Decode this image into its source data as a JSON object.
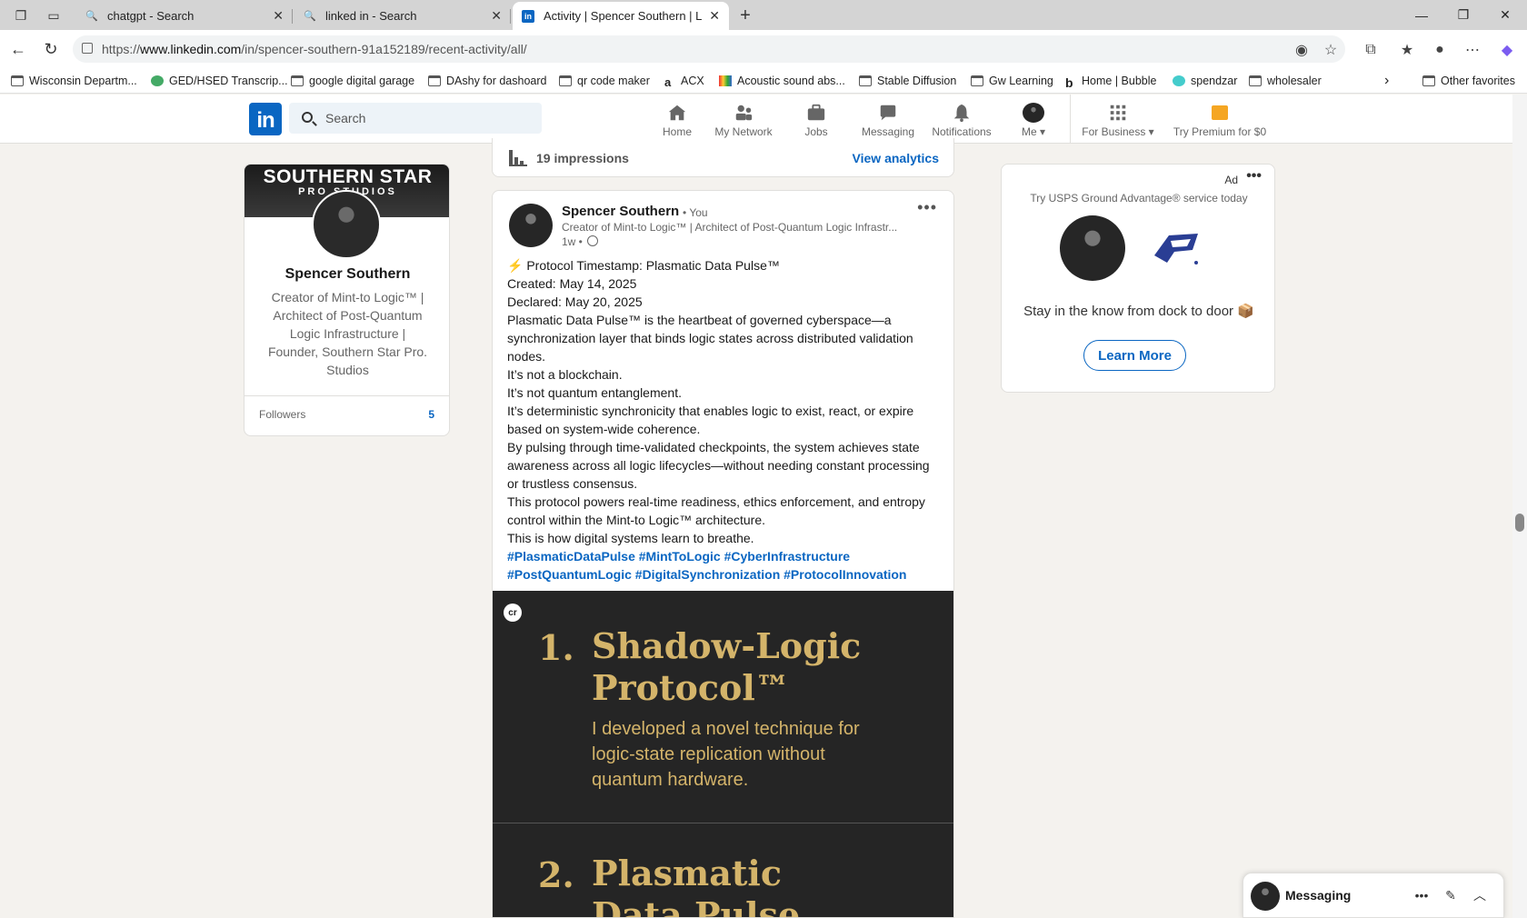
{
  "browser": {
    "tabs": [
      {
        "title": "chatgpt - Search"
      },
      {
        "title": "linked in - Search"
      },
      {
        "title": "Activity | Spencer Southern | Linke"
      }
    ],
    "url_prefix": "https://",
    "url_domain": "www.linkedin.com",
    "url_path": "/in/spencer-southern-91a152189/recent-activity/all/",
    "bookmarks": [
      "Wisconsin Departm...",
      "GED/HSED Transcrip...",
      "google digital garage",
      "DAshy for dashoard",
      "qr code maker",
      "ACX",
      "Acoustic sound abs...",
      "Stable Diffusion",
      "Gw Learning",
      "Home | Bubble",
      "spendzar",
      "wholesaler"
    ],
    "other_favorites": "Other favorites"
  },
  "linkedin": {
    "search_placeholder": "Search",
    "nav": {
      "home": "Home",
      "network": "My Network",
      "jobs": "Jobs",
      "messaging": "Messaging",
      "notifications": "Notifications",
      "me": "Me",
      "business": "For Business",
      "premium": "Try Premium for $0"
    }
  },
  "profile": {
    "banner_title": "SOUTHERN STAR",
    "banner_sub": "PRO STUDIOS",
    "name": "Spencer Southern",
    "headline": "Creator of Mint-to Logic™ | Architect of Post-Quantum Logic Infrastructure | Founder, Southern Star Pro. Studios",
    "followers_label": "Followers",
    "followers_count": "5"
  },
  "prev_post": {
    "impressions": "19 impressions",
    "analytics_link": "View analytics"
  },
  "post": {
    "author": "Spencer Southern",
    "you": "• You",
    "headline": "Creator of Mint-to Logic™ | Architect of Post-Quantum Logic Infrastr...",
    "time": "1w •",
    "lines": [
      "⚡ Protocol Timestamp: Plasmatic Data Pulse™",
      " Created: May 14, 2025",
      " Declared: May 20, 2025",
      "Plasmatic Data Pulse™ is the heartbeat of governed cyberspace—a synchronization layer that binds logic states across distributed validation nodes.",
      "It’s not a blockchain.",
      " It’s not quantum entanglement.",
      " It’s deterministic synchronicity that enables logic to exist, react, or expire based on system-wide coherence.",
      "By pulsing through time-validated checkpoints, the system achieves state awareness across all logic lifecycles—without needing constant processing or trustless consensus.",
      "This protocol powers real-time readiness, ethics enforcement, and entropy control within the Mint-to Logic™ architecture.",
      "This is how digital systems learn to breathe."
    ],
    "hashtags_1": "#PlasmaticDataPulse #MintToLogic #CyberInfrastructure",
    "hashtags_2": "#PostQuantumLogic #DigitalSynchronization #ProtocolInnovation",
    "image": {
      "badge": "cr",
      "slide1_num": "1.",
      "slide1_title_1": "Shadow-Logic",
      "slide1_title_2": "Protocol™",
      "slide1_desc": "I developed a novel technique for logic-state replication without quantum hardware.",
      "slide2_num": "2.",
      "slide2_title_1": "Plasmatic",
      "slide2_title_2": "Data Pulse"
    }
  },
  "ad": {
    "label": "Ad",
    "tagline": "Try USPS Ground Advantage® service today",
    "text": "Stay in the know from dock to door 📦",
    "button": "Learn More"
  },
  "messaging": {
    "label": "Messaging"
  },
  "colors": {
    "linkedin_blue": "#0a66c2",
    "page_bg": "#f4f2ee",
    "slide_gold": "#d4b46a",
    "slide_bg": "#252525"
  }
}
